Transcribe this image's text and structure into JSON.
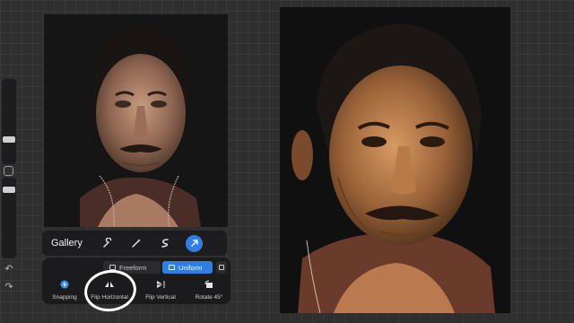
{
  "toolbar": {
    "gallery_label": "Gallery",
    "tools": [
      "wrench-icon",
      "magic-wand-icon",
      "selection-icon",
      "transform-arrow-icon"
    ]
  },
  "transform": {
    "modes": {
      "freeform": "Freeform",
      "uniform": "Uniform"
    },
    "actions": {
      "snapping": "Snapping",
      "flip_horizontal": "Flip Horizontal",
      "flip_vertical": "Flip Vertical",
      "rotate": "Rotate 45°"
    }
  },
  "colors": {
    "accent": "#2d7fe6",
    "panel": "#1b1b1d",
    "canvas_bg": "#2f2f2f"
  }
}
